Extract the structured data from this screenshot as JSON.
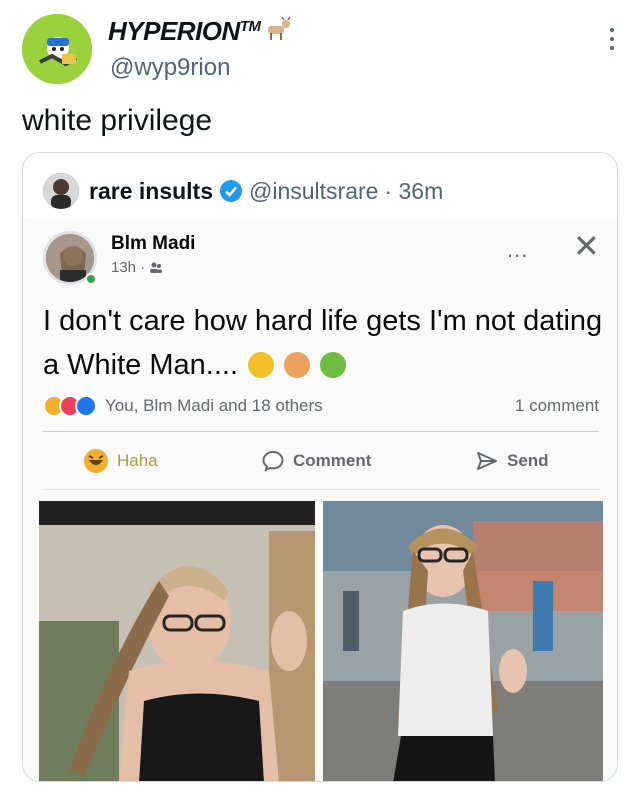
{
  "tweet": {
    "display_name": "HYPERION",
    "tm": "TM",
    "handle": "@wyp9rion",
    "text": "white privilege",
    "icons": {
      "avatar": "cartoon-avatar",
      "badge": "goat-icon",
      "menu": "more-icon"
    }
  },
  "quote": {
    "name": "rare insults",
    "handle": "@insultsrare",
    "time": "· 36m",
    "verified_color": "#1d9bf0",
    "post": {
      "author": "Blm Madi",
      "meta": "13h ·",
      "more": "...",
      "close": "✕",
      "text": "I don't care how hard life gets I'm not dating a White Man....",
      "reactions_text": "You, Blm Madi and 18 others",
      "comment_count": "1 comment",
      "actions": {
        "haha": "Haha",
        "comment": "Comment",
        "send": "Send"
      }
    }
  },
  "colors": {
    "accent": "#1d9bf0",
    "fb_gray": "#65676b",
    "haha_yellow": "#f7b125"
  }
}
